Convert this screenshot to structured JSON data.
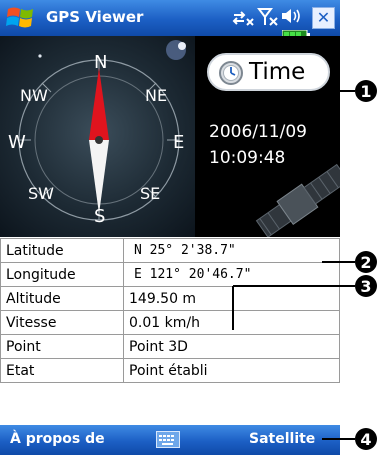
{
  "titlebar": {
    "app_title": "GPS Viewer",
    "close_label": "✕"
  },
  "compass": {
    "directions": {
      "n": "N",
      "nw": "NW",
      "ne": "NE",
      "w": "W",
      "e": "E",
      "sw": "SW",
      "se": "SE",
      "s": "S"
    }
  },
  "time_panel": {
    "button_label": "Time",
    "date": "2006/11/09",
    "time": "10:09:48"
  },
  "table": {
    "rows": [
      {
        "label": "Latitude",
        "value": "N  25°  2'38.7\""
      },
      {
        "label": "Longitude",
        "value": "E 121° 20'46.7\""
      },
      {
        "label": "Altitude",
        "value": "149.50 m"
      },
      {
        "label": "Vitesse",
        "value": "0.01 km/h"
      },
      {
        "label": "Point",
        "value": "Point 3D"
      },
      {
        "label": "Etat",
        "value": "Point établi"
      }
    ]
  },
  "menubar": {
    "left_label": "À propos de",
    "right_label": "Satellite"
  },
  "callouts": [
    "1",
    "2",
    "3",
    "4"
  ],
  "colors": {
    "titlebar_blue": "#1c5fc4",
    "needle_red": "#e0141e",
    "callout_black": "#000000"
  },
  "icons": [
    "windows-start-flag-icon",
    "connectivity-icon",
    "signal-icon",
    "volume-icon",
    "battery-icon",
    "clock-icon",
    "keyboard-icon",
    "close-icon"
  ]
}
